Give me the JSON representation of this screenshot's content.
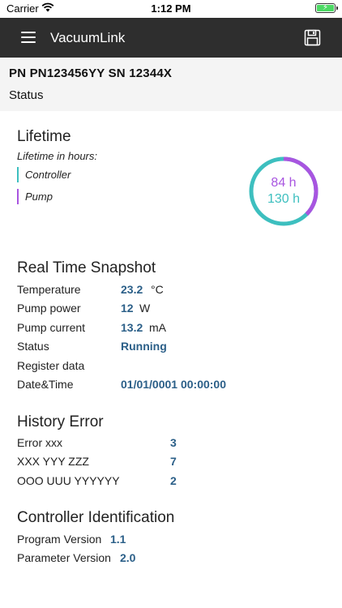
{
  "status_bar": {
    "carrier": "Carrier",
    "time": "1:12 PM",
    "battery_icon": "battery-charging-icon",
    "wifi_icon": "wifi-icon"
  },
  "navbar": {
    "title": "VacuumLink",
    "menu_icon": "hamburger-menu-icon",
    "save_icon": "floppy-disk-icon",
    "background": "#2e2e2e"
  },
  "header": {
    "pn_sn": "PN PN123456YY  SN 12344X",
    "status_label": "Status"
  },
  "lifetime": {
    "title": "Lifetime",
    "subtitle": "Lifetime in hours:",
    "legend": [
      {
        "label": "Controller",
        "color": "#3dbfbf"
      },
      {
        "label": "Pump",
        "color": "#a855e0"
      }
    ],
    "gauge": {
      "pump_value": "84 h",
      "controller_value": "130 h"
    }
  },
  "snapshot": {
    "title": "Real Time Snapshot",
    "temperature": {
      "label": "Temperature",
      "value": "23.2",
      "unit": "°C"
    },
    "pump_power": {
      "label": "Pump power",
      "value": "12",
      "unit": "W"
    },
    "pump_current": {
      "label": "Pump current",
      "value": "13.2",
      "unit": "mA"
    },
    "status": {
      "label": "Status",
      "value": "Running"
    },
    "register": {
      "label": "Register data"
    },
    "datetime": {
      "label": "Date&Time",
      "value": "01/01/0001 00:00:00"
    }
  },
  "history": {
    "title": "History Error",
    "rows": [
      {
        "label": "Error xxx",
        "value": "3"
      },
      {
        "label": "XXX YYY ZZZ",
        "value": "7"
      },
      {
        "label": "OOO UUU YYYYYY",
        "value": "2"
      }
    ]
  },
  "identification": {
    "title": "Controller Identification",
    "program": {
      "label": "Program Version",
      "value": "1.1"
    },
    "parameter": {
      "label": "Parameter Version",
      "value": "2.0"
    }
  },
  "accent_value_color": "#2b5f88"
}
